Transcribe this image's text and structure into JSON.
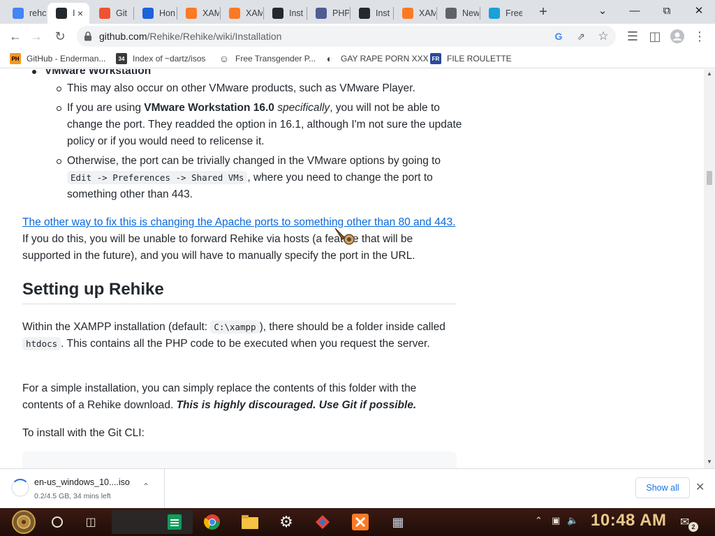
{
  "tabs": [
    {
      "label": "rehc",
      "icon": "google-icon",
      "color": "#4285f4"
    },
    {
      "label": "I",
      "icon": "github-icon",
      "color": "#24292f",
      "active": true
    },
    {
      "label": "Git",
      "icon": "git-icon",
      "color": "#f05133"
    },
    {
      "label": "Hon",
      "icon": "bird-icon",
      "color": "#1d63d9"
    },
    {
      "label": "XAM",
      "icon": "xampp-diamond-icon",
      "color": "#fb7a24"
    },
    {
      "label": "XAM",
      "icon": "xampp-icon",
      "color": "#fb7a24"
    },
    {
      "label": "Inst",
      "icon": "github-icon",
      "color": "#24292f"
    },
    {
      "label": "PHP",
      "icon": "php-icon",
      "color": "#4f5b93"
    },
    {
      "label": "Inst",
      "icon": "github-icon",
      "color": "#24292f"
    },
    {
      "label": "XAM",
      "icon": "xampp-icon",
      "color": "#fb7a24"
    },
    {
      "label": "New",
      "icon": "chrome-icon",
      "color": "#5f6368"
    },
    {
      "label": "Free",
      "icon": "translate-icon",
      "color": "#1aa1d6"
    }
  ],
  "toolbar": {
    "url_host": "github.com",
    "url_path": "/Rehike/Rehike/wiki/Installation"
  },
  "bookmarks": [
    {
      "label": "GitHub - Enderman...",
      "icon": "ph-icon",
      "badge": "PH"
    },
    {
      "label": "Index of ~dartz/isos",
      "icon": "index-icon",
      "badge": "34"
    },
    {
      "label": "Free Transgender P...",
      "icon": "mask-icon",
      "badge": ""
    },
    {
      "label": "GAY RAPE PORN XXX",
      "icon": "globe-icon",
      "badge": ""
    },
    {
      "label": "FILE ROULETTE",
      "icon": "file-roulette-icon",
      "badge": "FR"
    }
  ],
  "article": {
    "top_bullet": "VMware Workstation",
    "sub1": "This may also occur on other VMware products, such as VMware Player.",
    "sub2_pre": "If you are using ",
    "sub2_bold": "VMware Workstation 16.0",
    "sub2_ital": " specifically",
    "sub2_rest": ", you will not be able to change the port. They readded the option in 16.1, although I'm not sure the update policy or if you would need to relicense it.",
    "sub3_pre": "Otherwise, the port can be trivially changed in the VMware options by going to",
    "sub3_code": "Edit -> Preferences -> Shared VMs",
    "sub3_rest": ", where you need to change the port to something other than 443.",
    "link_text": "The other way to fix this is changing the Apache ports to something other than 80 and 443.",
    "link_rest": " If you do this, you will be unable to forward Rehike via hosts (a feature that will be supported in the future), and you will have to manually specify the port in the URL.",
    "heading": "Setting up Rehike",
    "p1_a": "Within the XAMPP installation (default: ",
    "p1_code1": "C:\\xampp",
    "p1_b": "), there should be a folder inside called ",
    "p1_code2": "htdocs",
    "p1_c": ". This contains all the PHP code to be executed when you request the server.",
    "p2_a": "For a simple installation, you can simply replace the contents of this folder with the contents of a Rehike download. ",
    "p2_b": "This is highly discouraged. Use Git if possible.",
    "p3": "To install with the Git CLI:"
  },
  "download": {
    "filename": "en-us_windows_10....iso",
    "status": "0.2/4.5 GB, 34 mins left",
    "show_all": "Show all"
  },
  "taskbar": {
    "clock": "10:48 AM",
    "notifications": "2"
  }
}
